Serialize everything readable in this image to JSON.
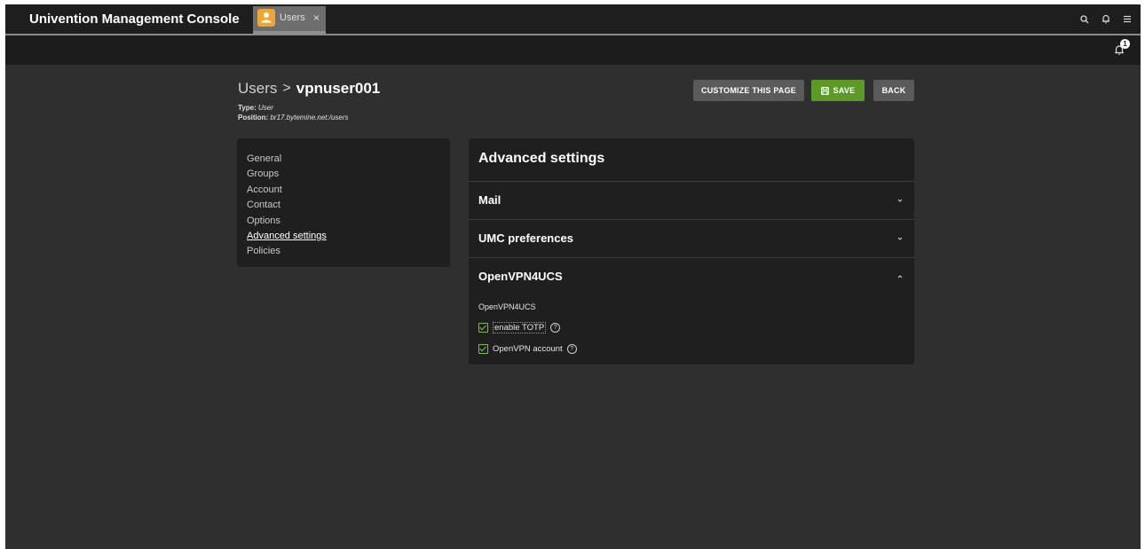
{
  "app": {
    "title": "Univention Management Console"
  },
  "tab": {
    "label": "Users",
    "close": "×",
    "icon": "user-icon"
  },
  "topbar": {
    "icons": [
      "search-icon",
      "bell-icon",
      "menu-icon"
    ]
  },
  "notifications": {
    "count": "1"
  },
  "breadcrumb": {
    "parent": "Users",
    "separator": ">",
    "current": "vpnuser001"
  },
  "meta": {
    "type_label": "Type:",
    "type_value": "User",
    "position_label": "Position:",
    "position_value": "br17.bytemine.net:/users"
  },
  "buttons": {
    "customize": "CUSTOMIZE THIS PAGE",
    "save": "SAVE",
    "back": "BACK"
  },
  "sidenav": {
    "items": [
      "General",
      "Groups",
      "Account",
      "Contact",
      "Options",
      "Advanced settings",
      "Policies"
    ],
    "active": "Advanced settings"
  },
  "panel": {
    "title": "Advanced settings",
    "sections": [
      {
        "label": "Mail",
        "expanded": false
      },
      {
        "label": "UMC preferences",
        "expanded": false
      },
      {
        "label": "OpenVPN4UCS",
        "expanded": true
      }
    ],
    "openvpn": {
      "group_label": "OpenVPN4UCS",
      "options": [
        {
          "label": "enable TOTP",
          "checked": true
        },
        {
          "label": "OpenVPN account",
          "checked": true
        }
      ]
    }
  },
  "colors": {
    "accent_save": "#5b9a27",
    "tab_icon": "#f0a533",
    "checkbox": "#7cbf3b"
  }
}
